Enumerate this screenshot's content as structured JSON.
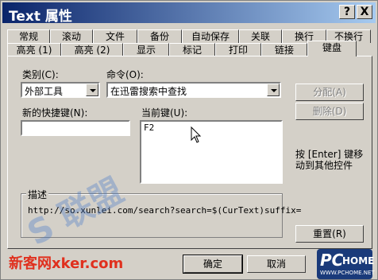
{
  "window": {
    "title": "Text 属性"
  },
  "titlebar_buttons": {
    "help": "?",
    "close": "X"
  },
  "tabs_row1": [
    "常规",
    "滚动",
    "文件",
    "备份",
    "自动保存",
    "关联",
    "换行",
    "不换行"
  ],
  "tabs_row2": [
    "高亮 (1)",
    "高亮 (2)",
    "显示",
    "标记",
    "打印",
    "链接",
    "键盘"
  ],
  "form": {
    "category_label": "类别(C):",
    "category_value": "外部工具",
    "command_label": "命令(O):",
    "command_value": "在迅雷搜索中查找",
    "new_shortcut_label": "新的快捷键(N):",
    "new_shortcut_value": "",
    "current_keys_label": "当前键(U):",
    "current_keys": [
      "F2"
    ],
    "assign_button": "分配(A)",
    "delete_button": "删除(D)",
    "hint": "按 [Enter] 键移动到其他控件",
    "description_label": "描述",
    "description_text": "http://so.xunlei.com/search?search=$(CurText)suffix=",
    "reset_button": "重置(R)"
  },
  "footer": {
    "ok": "确定",
    "cancel": "取消"
  },
  "watermarks": {
    "left": "新客网xker.com",
    "right_top": "PC",
    "right_brand": "HOME",
    "right_url": "WWW.PCHOME.NET",
    "center": "S 联盟"
  },
  "colors": {
    "titlebar_start": "#0a246a",
    "titlebar_end": "#a6caf0",
    "face": "#d4d0c8"
  }
}
